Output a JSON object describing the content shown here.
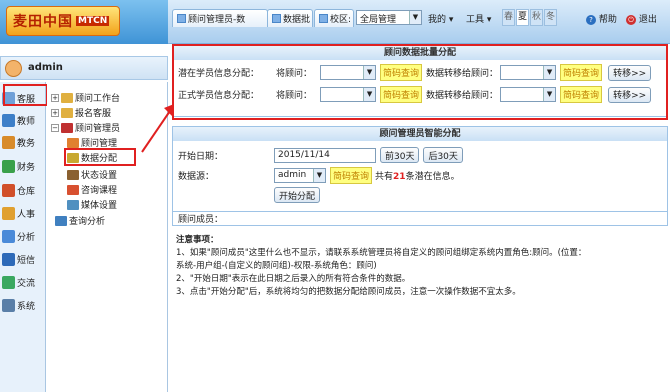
{
  "brand": {
    "name": "麦田中国",
    "tag": "MTCN"
  },
  "topbar": {
    "tab1": "顾问管理员-数",
    "tab2": "数据批",
    "tab3": "校区:",
    "campus": "全局管理",
    "mine": "我的",
    "tools": "工具",
    "seasons": [
      "春",
      "夏",
      "秋",
      "冬"
    ],
    "help": "帮助",
    "logout": "退出"
  },
  "user": {
    "name": "admin"
  },
  "nav": [
    "客服",
    "教师",
    "教务",
    "财务",
    "仓库",
    "人事",
    "分析",
    "短信",
    "交流",
    "系统"
  ],
  "tree": {
    "workbench": "顾问工作台",
    "signup": "报名客服",
    "consultant_admin": "顾问管理员",
    "consultant_mgmt": "顾问管理",
    "data_dist": "数据分配",
    "status": "状态设置",
    "course": "咨询课程",
    "media": "媒体设置",
    "query": "查询分析"
  },
  "batch": {
    "title": "顾问数据批量分配",
    "potential": "潜在学员信息分配：",
    "formal": "正式学员信息分配：",
    "consultant": "将顾问：",
    "query": "简码查询",
    "transfer_to": "数据转移给顾问：",
    "transfer_btn": "转移>>"
  },
  "smart": {
    "title": "顾问管理员智能分配",
    "start_label": "开始日期：",
    "start_date": "2015/11/14",
    "prev30": "前30天",
    "next30": "后30天",
    "source_label": "数据源：",
    "source_value": "admin",
    "query": "简码查询",
    "count_prefix": "共有",
    "count": "21",
    "count_suffix": "条潜在信息。",
    "start_btn": "开始分配",
    "members": "顾问成员："
  },
  "notes": {
    "title": "注意事项：",
    "line1": "1、如果\"顾问成员\"这里什么也不显示，请联系系统管理员将自定义的顾问组绑定系统内置角色:顾问。(位置：",
    "line1b": "系统-用户组-(自定义的顾问组)-权限-系统角色：顾问)",
    "line2": "2、\"开始日期\"表示在此日期之后录入的所有符合条件的数据。",
    "line3": "3、点击\"开始分配\"后，系统将均匀的把数据分配给顾问成员，注意一次操作数据不宜太多。"
  },
  "colors": {
    "accent": "#3f93d6",
    "highlight": "#e02020"
  }
}
